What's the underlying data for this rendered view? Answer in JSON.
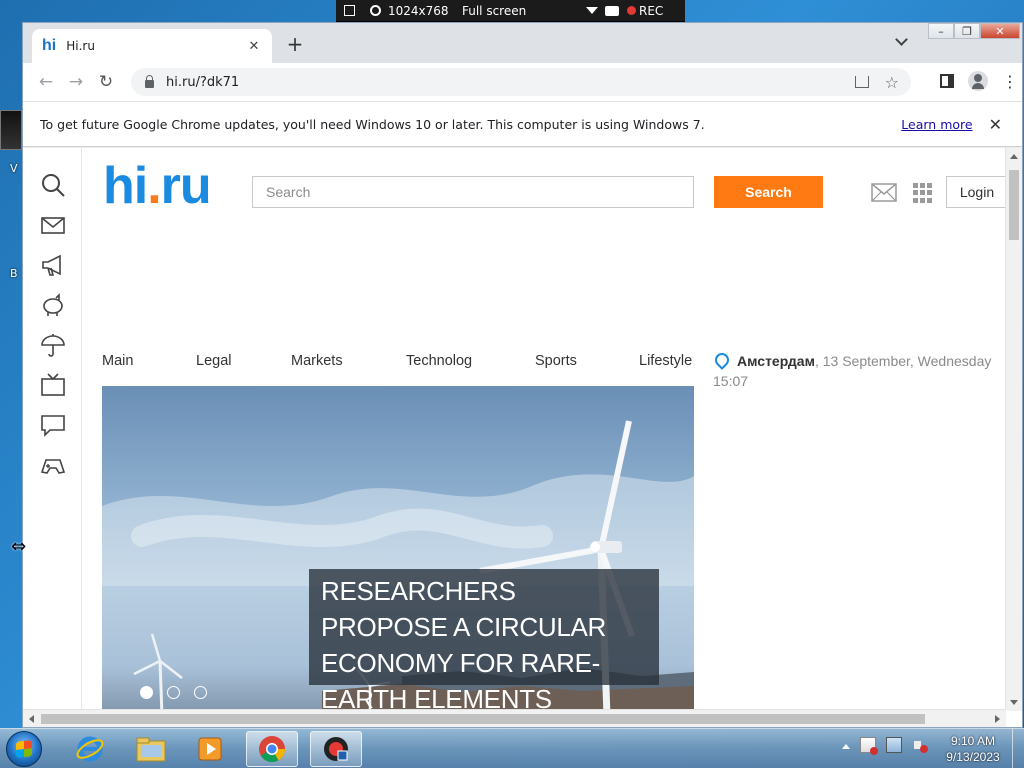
{
  "recorder": {
    "resolution": "1024x768",
    "mode": "Full screen",
    "rec_label": "REC"
  },
  "desktop": {
    "label_a": "V",
    "label_b": "B"
  },
  "browser": {
    "tab_title": "Hi.ru",
    "tab_favicon": "hi",
    "url": "hi.ru/?dk71",
    "infobar_message": "To get future Google Chrome updates, you'll need Windows 10 or later. This computer is using Windows 7.",
    "infobar_link": "Learn more"
  },
  "site": {
    "logo_main": "hi",
    "logo_dot": ".",
    "logo_tld": "ru",
    "search_placeholder": "Search",
    "search_button": "Search",
    "login_button": "Login",
    "menu": [
      {
        "label": "Main"
      },
      {
        "label": "Legal"
      },
      {
        "label": "Markets"
      },
      {
        "label": "Technolog"
      },
      {
        "label": "Sports"
      },
      {
        "label": "Lifestyle"
      }
    ],
    "weather": {
      "city": "Амстердам",
      "date": ", 13 September, Wednesday",
      "time": "15:07"
    },
    "hero": {
      "headline": "RESEARCHERS PROPOSE A CIRCULAR ECONOMY FOR RARE-EARTH ELEMENTS",
      "slides": 3,
      "active_slide": 1
    }
  },
  "taskbar": {
    "time": "9:10 AM",
    "date": "9/13/2023"
  },
  "colors": {
    "brand_blue": "#1a8be0",
    "brand_orange": "#ff7a12"
  }
}
